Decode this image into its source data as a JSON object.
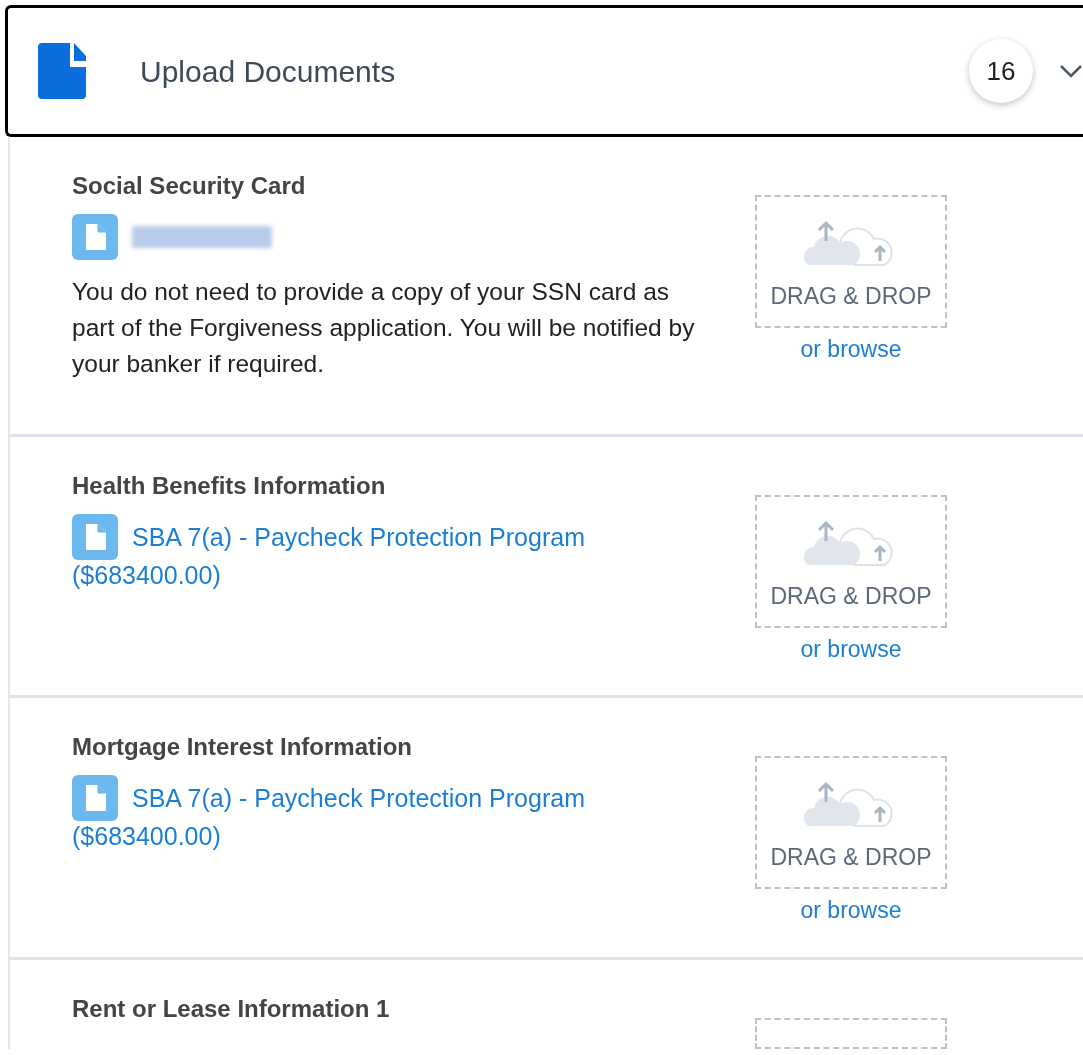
{
  "header": {
    "title": "Upload Documents",
    "count": "16",
    "expanded": true
  },
  "sections": [
    {
      "title": "Social Security Card",
      "file": {
        "kind": "redacted"
      },
      "note": "You do not need to provide a copy of your SSN card as part of the Forgiveness application. You will be notified by your banker if required.",
      "drop": {
        "label": "DRAG & DROP",
        "browse": "or browse"
      }
    },
    {
      "title": "Health Benefits Information",
      "file": {
        "kind": "link",
        "text": "SBA 7(a) - Paycheck Protection Program",
        "amount": "($683400.00)"
      },
      "drop": {
        "label": "DRAG & DROP",
        "browse": "or browse"
      }
    },
    {
      "title": "Mortgage Interest Information",
      "file": {
        "kind": "link",
        "text": "SBA 7(a) - Paycheck Protection Program",
        "amount": "($683400.00)"
      },
      "drop": {
        "label": "DRAG & DROP",
        "browse": "or browse"
      }
    },
    {
      "title": "Rent or Lease Information 1"
    }
  ]
}
